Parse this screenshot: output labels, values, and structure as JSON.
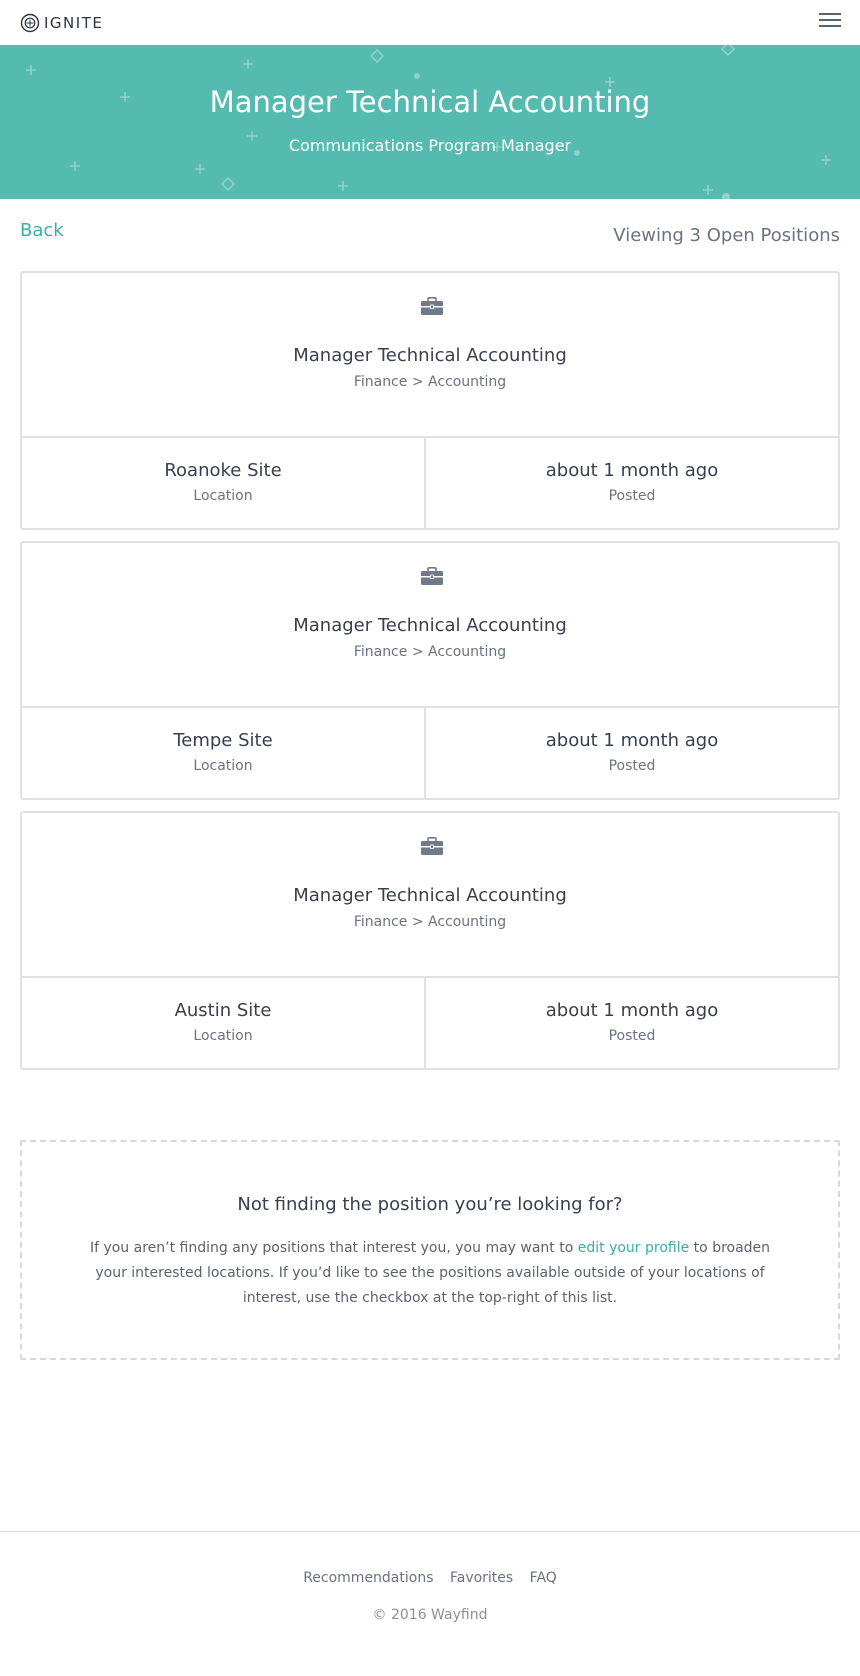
{
  "brand": {
    "name": "IGNITE"
  },
  "header": {
    "menu_icon": "hamburger-menu-icon"
  },
  "hero": {
    "title": "Manager Technical Accounting",
    "subtitle": "Communications Program Manager",
    "background_color": "#55bbb1"
  },
  "toolbar": {
    "back_label": "Back",
    "viewing_text": "Viewing 3 Open Positions"
  },
  "positions": [
    {
      "icon": "briefcase-icon",
      "title": "Manager Technical Accounting",
      "category": "Finance > Accounting",
      "location": "Roanoke Site",
      "location_label": "Location",
      "posted": "about 1 month ago",
      "posted_label": "Posted"
    },
    {
      "icon": "briefcase-icon",
      "title": "Manager Technical Accounting",
      "category": "Finance > Accounting",
      "location": "Tempe Site",
      "location_label": "Location",
      "posted": "about 1 month ago",
      "posted_label": "Posted"
    },
    {
      "icon": "briefcase-icon",
      "title": "Manager Technical Accounting",
      "category": "Finance > Accounting",
      "location": "Austin Site",
      "location_label": "Location",
      "posted": "about 1 month ago",
      "posted_label": "Posted"
    }
  ],
  "info": {
    "title": "Not finding the position you’re looking for?",
    "text_before": "If you aren’t finding any positions that interest you, you may want to ",
    "link_text": "edit your profile",
    "text_after": " to broaden your interested locations. If you’d like to see the positions available outside of your locations of interest, use the checkbox at the top-right of this list."
  },
  "footer": {
    "links": [
      "Recommendations",
      "Favorites",
      "FAQ"
    ],
    "copyright": "© 2016 Wayfind"
  },
  "colors": {
    "accent": "#3aaea4",
    "border": "#dfe1e4",
    "text": "#38404d",
    "muted": "#6a7380"
  }
}
